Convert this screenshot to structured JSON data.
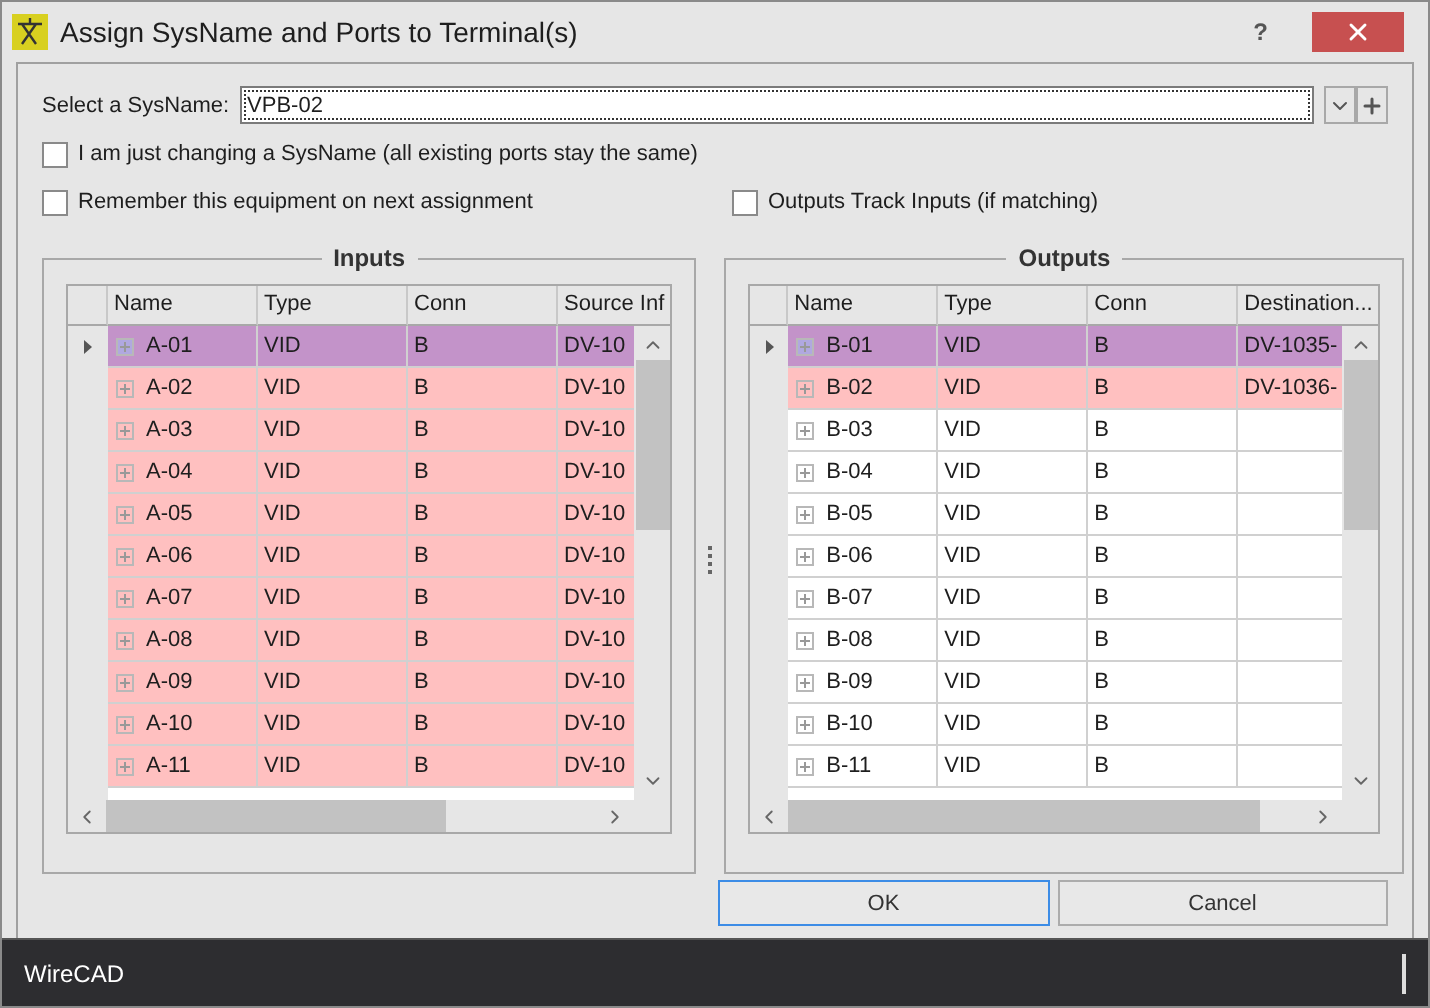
{
  "window": {
    "title": "Assign SysName and Ports to Terminal(s)",
    "help": "?"
  },
  "sysname": {
    "label": "Select a SysName:",
    "value": "VPB-02"
  },
  "options": [
    {
      "label": "I am just changing a SysName (all existing ports stay the same)",
      "checked": false
    },
    {
      "label": "Remember this equipment on next assignment",
      "checked": false
    },
    {
      "label": "Outputs Track Inputs (if matching)",
      "checked": false
    }
  ],
  "inputs": {
    "title": "Inputs",
    "columns": [
      "Name",
      "Type",
      "Conn",
      "Source Inf"
    ],
    "rows": [
      {
        "cells": [
          "A-01",
          "VID",
          "B",
          "DV-10"
        ],
        "selected": true,
        "assigned": true
      },
      {
        "cells": [
          "A-02",
          "VID",
          "B",
          "DV-10"
        ],
        "selected": false,
        "assigned": true
      },
      {
        "cells": [
          "A-03",
          "VID",
          "B",
          "DV-10"
        ],
        "selected": false,
        "assigned": true
      },
      {
        "cells": [
          "A-04",
          "VID",
          "B",
          "DV-10"
        ],
        "selected": false,
        "assigned": true
      },
      {
        "cells": [
          "A-05",
          "VID",
          "B",
          "DV-10"
        ],
        "selected": false,
        "assigned": true
      },
      {
        "cells": [
          "A-06",
          "VID",
          "B",
          "DV-10"
        ],
        "selected": false,
        "assigned": true
      },
      {
        "cells": [
          "A-07",
          "VID",
          "B",
          "DV-10"
        ],
        "selected": false,
        "assigned": true
      },
      {
        "cells": [
          "A-08",
          "VID",
          "B",
          "DV-10"
        ],
        "selected": false,
        "assigned": true
      },
      {
        "cells": [
          "A-09",
          "VID",
          "B",
          "DV-10"
        ],
        "selected": false,
        "assigned": true
      },
      {
        "cells": [
          "A-10",
          "VID",
          "B",
          "DV-10"
        ],
        "selected": false,
        "assigned": true
      },
      {
        "cells": [
          "A-11",
          "VID",
          "B",
          "DV-10"
        ],
        "selected": false,
        "assigned": true
      }
    ]
  },
  "outputs": {
    "title": "Outputs",
    "columns": [
      "Name",
      "Type",
      "Conn",
      "Destination..."
    ],
    "rows": [
      {
        "cells": [
          "B-01",
          "VID",
          "B",
          "DV-1035-"
        ],
        "selected": true,
        "assigned": true
      },
      {
        "cells": [
          "B-02",
          "VID",
          "B",
          "DV-1036-"
        ],
        "selected": false,
        "assigned": true
      },
      {
        "cells": [
          "B-03",
          "VID",
          "B",
          ""
        ],
        "selected": false,
        "assigned": false
      },
      {
        "cells": [
          "B-04",
          "VID",
          "B",
          ""
        ],
        "selected": false,
        "assigned": false
      },
      {
        "cells": [
          "B-05",
          "VID",
          "B",
          ""
        ],
        "selected": false,
        "assigned": false
      },
      {
        "cells": [
          "B-06",
          "VID",
          "B",
          ""
        ],
        "selected": false,
        "assigned": false
      },
      {
        "cells": [
          "B-07",
          "VID",
          "B",
          ""
        ],
        "selected": false,
        "assigned": false
      },
      {
        "cells": [
          "B-08",
          "VID",
          "B",
          ""
        ],
        "selected": false,
        "assigned": false
      },
      {
        "cells": [
          "B-09",
          "VID",
          "B",
          ""
        ],
        "selected": false,
        "assigned": false
      },
      {
        "cells": [
          "B-10",
          "VID",
          "B",
          ""
        ],
        "selected": false,
        "assigned": false
      },
      {
        "cells": [
          "B-11",
          "VID",
          "B",
          ""
        ],
        "selected": false,
        "assigned": false
      }
    ]
  },
  "buttons": [
    {
      "label": "OK",
      "focused": true
    },
    {
      "label": "Cancel",
      "focused": false
    }
  ],
  "status_bar": {
    "text": "WireCAD"
  }
}
